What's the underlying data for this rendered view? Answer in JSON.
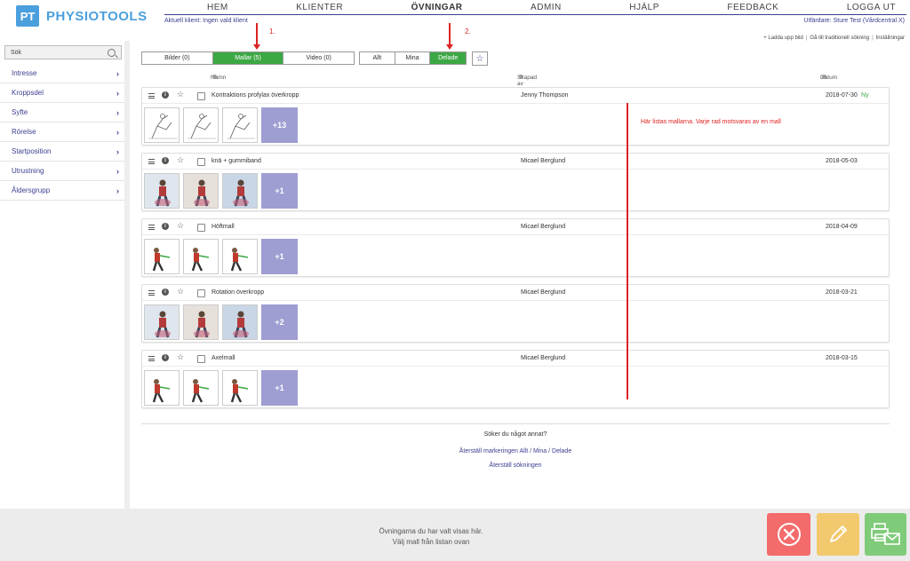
{
  "logo": {
    "badge": "PT",
    "name": "PHYSIOTOOLS"
  },
  "nav": {
    "items": [
      "HEM",
      "KLIENTER",
      "ÖVNINGAR",
      "ADMIN",
      "HJÄLP",
      "FEEDBACK",
      "LOGGA UT"
    ],
    "active": "ÖVNINGAR"
  },
  "header": {
    "client": "Aktuell klient: Ingen vald klient",
    "issuer": "Utfärdare: Sture Test (Vårdcentral X)",
    "links": [
      "+ Ladda upp bild",
      "Gå till traditionell sökning",
      "Inställningar"
    ]
  },
  "sidebar": {
    "search_placeholder": "Sök",
    "filters": [
      "Intresse",
      "Kroppsdel",
      "Syfte",
      "Rörelse",
      "Startposition",
      "Utrustning",
      "Åldersgrupp"
    ]
  },
  "tabs": {
    "media": [
      "Bilder (0)",
      "Mallar (5)",
      "Video (0)"
    ],
    "media_active": "Mallar (5)",
    "owner": [
      "Allt",
      "Mina",
      "Delade"
    ],
    "owner_active": "Delade"
  },
  "annotations": {
    "arrow1": "1.",
    "arrow2": "2.",
    "note": "Här listas mallarna. Varje rad motsvaras av en mall"
  },
  "columns": {
    "name": "Namn",
    "creator": "Skapad av",
    "date": "Datum"
  },
  "templates": [
    {
      "name": "Kontraktions profylax överkropp",
      "creator": "Jenny Thompson",
      "date": "2018-07-30",
      "badge": "Ny",
      "more": "+13",
      "thumbs": [
        "sketch",
        "sketch",
        "sketch"
      ]
    },
    {
      "name": "knä + gummiband",
      "creator": "Micael Berglund",
      "date": "2018-05-03",
      "badge": "",
      "more": "+1",
      "thumbs": [
        "photo",
        "photo",
        "photo"
      ]
    },
    {
      "name": "Höftmall",
      "creator": "Micael Berglund",
      "date": "2018-04-09",
      "badge": "",
      "more": "+1",
      "thumbs": [
        "render",
        "render",
        "render"
      ]
    },
    {
      "name": "Rotation överkropp",
      "creator": "Micael Berglund",
      "date": "2018-03-21",
      "badge": "",
      "more": "+2",
      "thumbs": [
        "photo",
        "photo",
        "photo"
      ]
    },
    {
      "name": "Axelmall",
      "creator": "Micael Berglund",
      "date": "2018-03-15",
      "badge": "",
      "more": "+1",
      "thumbs": [
        "render",
        "render",
        "render"
      ]
    }
  ],
  "search_other": {
    "question": "Söker du något annat?",
    "reset_filter": "Återställ markeringen Allt / Mina / Delade",
    "reset_search": "Återställ sökningen"
  },
  "bottom": {
    "line1": "Övningarna du har valt visas här.",
    "line2": "Välj mall från listan ovan"
  },
  "colors": {
    "accent": "#3b3e8f",
    "active_tab": "#3ca844",
    "more_tile": "#9e9ed2",
    "annotation": "#dd2222",
    "delete": "#f36b6b",
    "edit": "#f3c96e",
    "print": "#7fcb79"
  }
}
